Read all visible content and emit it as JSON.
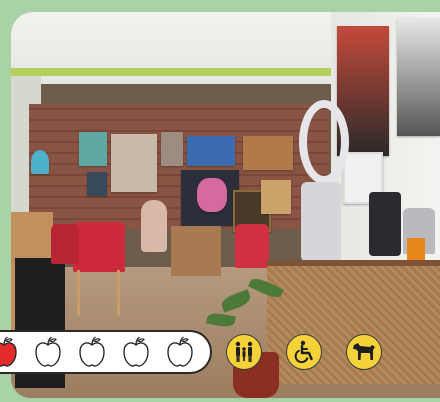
{
  "rating": {
    "max": 5,
    "value": 1,
    "filled_color": "#e52b2b",
    "empty_color": "#ffffff",
    "icon": "apple-icon"
  },
  "amenities": [
    {
      "icon": "family-icon",
      "color": "#f5d23a"
    },
    {
      "icon": "wheelchair-icon",
      "color": "#f5d23a"
    },
    {
      "icon": "dog-icon",
      "color": "#f5d23a"
    }
  ],
  "frame_color": "#a9d2a6"
}
